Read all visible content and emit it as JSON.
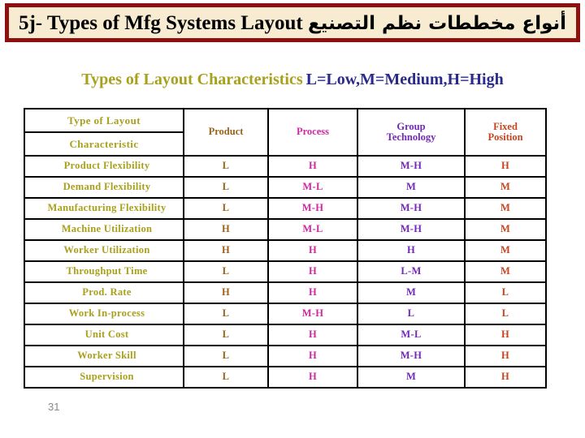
{
  "slide": {
    "title_en": "5j- Types of Mfg Systems Layout",
    "title_ar": "أنواع مخططات نظم التصنيع",
    "page_number": "31",
    "banner_fill": "#f7ecd2",
    "banner_border": "#8e1010"
  },
  "subtitle": {
    "main": "Types of Layout Characteristics",
    "legend": "L=Low,M=Medium,H=High",
    "main_color": "#a9a01e",
    "legend_color": "#2a2a8c"
  },
  "table": {
    "corner_header": {
      "line1": "Type of Layout",
      "line2": "Characteristic",
      "color": "#a9a01e"
    },
    "columns": [
      {
        "label": "Product",
        "color": "#9a631b"
      },
      {
        "label": "Process",
        "color": "#cc2aa0"
      },
      {
        "label_line1": "Group",
        "label_line2": "Technology",
        "color": "#7228bb"
      },
      {
        "label_line1": "Fixed",
        "label_line2": "Position",
        "color": "#c4441e"
      }
    ],
    "rows": [
      {
        "characteristic": "Product Flexibility",
        "product": "L",
        "process": "H",
        "group_technology": "M-H",
        "fixed_position": "H"
      },
      {
        "characteristic": "Demand Flexibility",
        "product": "L",
        "process": "M-L",
        "group_technology": "M",
        "fixed_position": "M"
      },
      {
        "characteristic": "Manufacturing Flexibility",
        "product": "L",
        "process": "M-H",
        "group_technology": "M-H",
        "fixed_position": "M"
      },
      {
        "characteristic": "Machine Utilization",
        "product": "H",
        "process": "M-L",
        "group_technology": "M-H",
        "fixed_position": "M"
      },
      {
        "characteristic": "Worker Utilization",
        "product": "H",
        "process": "H",
        "group_technology": "H",
        "fixed_position": "M"
      },
      {
        "characteristic": "Throughput Time",
        "product": "L",
        "process": "H",
        "group_technology": "L-M",
        "fixed_position": "M"
      },
      {
        "characteristic": "Prod. Rate",
        "product": "H",
        "process": "H",
        "group_technology": "M",
        "fixed_position": "L"
      },
      {
        "characteristic": "Work In-process",
        "product": "L",
        "process": "M-H",
        "group_technology": "L",
        "fixed_position": "L"
      },
      {
        "characteristic": "Unit Cost",
        "product": "L",
        "process": "H",
        "group_technology": "M-L",
        "fixed_position": "H"
      },
      {
        "characteristic": "Worker Skill",
        "product": "L",
        "process": "H",
        "group_technology": "M-H",
        "fixed_position": "H"
      },
      {
        "characteristic": "Supervision",
        "product": "L",
        "process": "H",
        "group_technology": "M",
        "fixed_position": "H"
      }
    ]
  }
}
